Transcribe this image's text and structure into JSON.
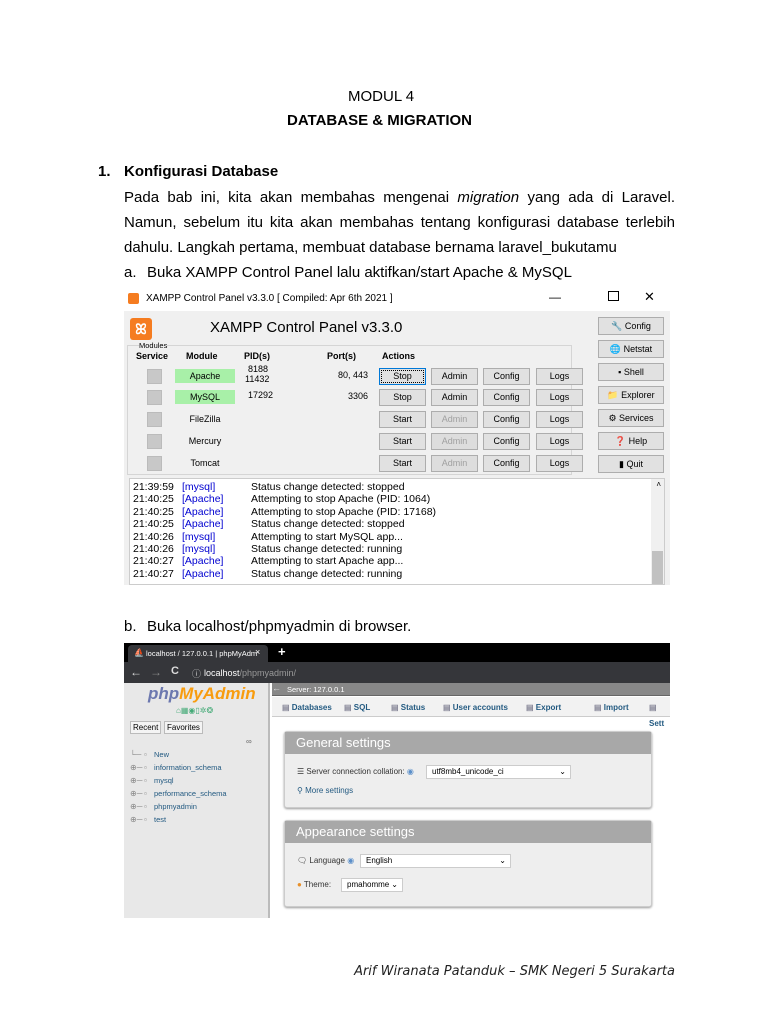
{
  "doc": {
    "module": "MODUL 4",
    "title": "DATABASE & MIGRATION",
    "section_number": "1.",
    "section_title": "Konfigurasi Database",
    "para_line1_a": "Pada bab ini, kita akan membahas mengenai",
    "para_line1_em": "migration",
    "para_line1_b": "yang ada di Laravel.",
    "para_line2": "Namun, sebelum itu kita akan membahas tentang konfigurasi database terlebih",
    "para_line3": "dahulu. Langkah pertama, membuat database bernama laravel_bukutamu",
    "step_a_label": "a.",
    "step_a": "Buka XAMPP Control Panel lalu aktifkan/start Apache & MySQL",
    "step_b_label": "b.",
    "step_b": "Buka localhost/phpmyadmin di browser.",
    "footer": "Arif Wiranata Patanduk – SMK Negeri 5 Surakarta"
  },
  "xampp": {
    "window_title": "XAMPP Control Panel v3.3.0   [ Compiled: Apr 6th 2021 ]",
    "heading": "XAMPP Control Panel v3.3.0",
    "modules_label": "Modules",
    "headers": {
      "service": "Service",
      "module": "Module",
      "pid": "PID(s)",
      "port": "Port(s)",
      "actions": "Actions"
    },
    "rows": [
      {
        "module": "Apache",
        "pid": "8188",
        "pid2": "11432",
        "port": "80, 443",
        "action": "Stop",
        "admin": "Admin",
        "config": "Config",
        "logs": "Logs"
      },
      {
        "module": "MySQL",
        "pid": "17292",
        "pid2": "",
        "port": "3306",
        "action": "Stop",
        "admin": "Admin",
        "config": "Config",
        "logs": "Logs"
      },
      {
        "module": "FileZilla",
        "pid": "",
        "pid2": "",
        "port": "",
        "action": "Start",
        "admin": "Admin",
        "config": "Config",
        "logs": "Logs"
      },
      {
        "module": "Mercury",
        "pid": "",
        "pid2": "",
        "port": "",
        "action": "Start",
        "admin": "Admin",
        "config": "Config",
        "logs": "Logs"
      },
      {
        "module": "Tomcat",
        "pid": "",
        "pid2": "",
        "port": "",
        "action": "Start",
        "admin": "Admin",
        "config": "Config",
        "logs": "Logs"
      }
    ],
    "side_buttons": [
      "Config",
      "Netstat",
      "Shell",
      "Explorer",
      "Services",
      "Help",
      "Quit"
    ],
    "log": [
      {
        "time": "21:39:59",
        "src": "[mysql]",
        "msg": "Status change detected: stopped"
      },
      {
        "time": "21:40:25",
        "src": "[Apache]",
        "msg": "Attempting to stop Apache (PID: 1064)"
      },
      {
        "time": "21:40:25",
        "src": "[Apache]",
        "msg": "Attempting to stop Apache (PID: 17168)"
      },
      {
        "time": "21:40:25",
        "src": "[Apache]",
        "msg": "Status change detected: stopped"
      },
      {
        "time": "21:40:26",
        "src": "[mysql]",
        "msg": "Attempting to start MySQL app..."
      },
      {
        "time": "21:40:26",
        "src": "[mysql]",
        "msg": "Status change detected: running"
      },
      {
        "time": "21:40:27",
        "src": "[Apache]",
        "msg": "Attempting to start Apache app..."
      },
      {
        "time": "21:40:27",
        "src": "[Apache]",
        "msg": "Status change detected: running"
      }
    ]
  },
  "pma": {
    "tab_title": "localhost / 127.0.0.1 | phpMyAdm",
    "url_host": "localhost",
    "url_path": "/phpmyadmin/",
    "logo_php": "php",
    "logo_my": "MyAdmin",
    "recent": "Recent",
    "favorites": "Favorites",
    "tree": [
      "New",
      "information_schema",
      "mysql",
      "performance_schema",
      "phpmyadmin",
      "test"
    ],
    "server": "Server: 127.0.0.1",
    "tabs": [
      "Databases",
      "SQL",
      "Status",
      "User accounts",
      "Export",
      "Import",
      "Sett"
    ],
    "general_title": "General settings",
    "collation_label": "Server connection collation:",
    "collation_value": "utf8mb4_unicode_ci",
    "more_settings": "More settings",
    "appearance_title": "Appearance settings",
    "language_label": "Language",
    "language_value": "English",
    "theme_label": "Theme:",
    "theme_value": "pmahomme"
  }
}
